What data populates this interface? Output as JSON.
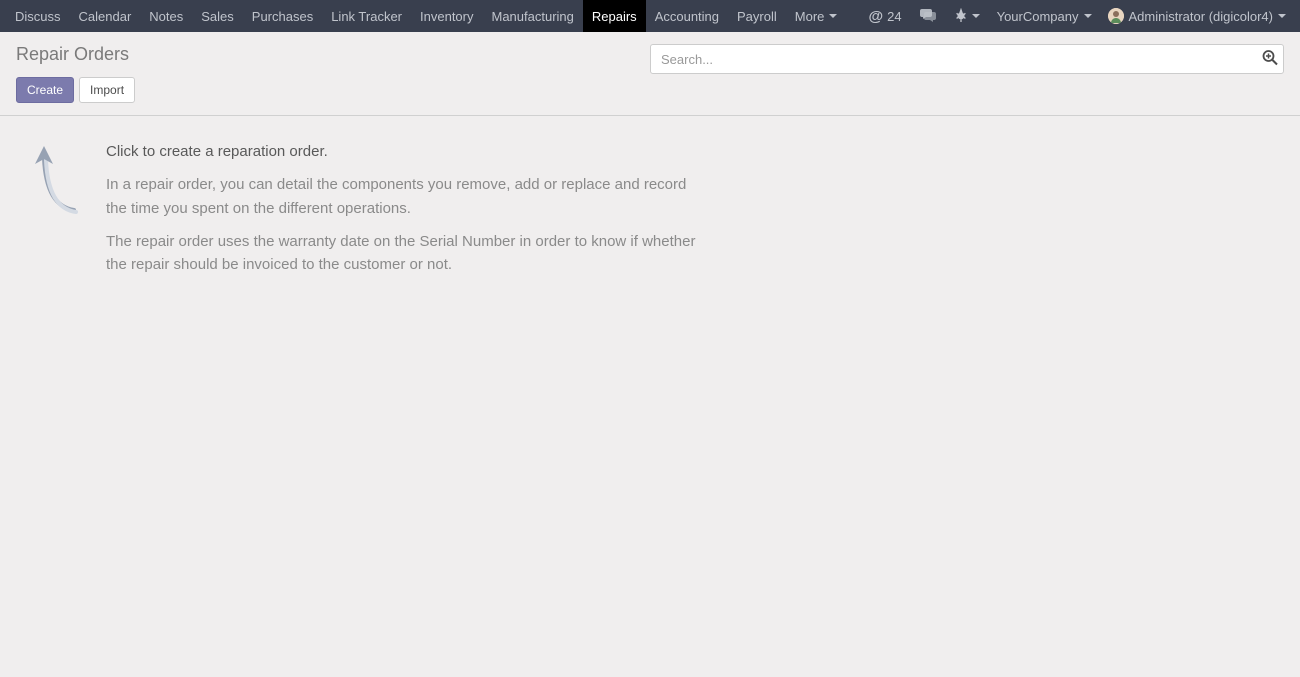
{
  "nav": {
    "items": [
      {
        "label": "Discuss",
        "active": false
      },
      {
        "label": "Calendar",
        "active": false
      },
      {
        "label": "Notes",
        "active": false
      },
      {
        "label": "Sales",
        "active": false
      },
      {
        "label": "Purchases",
        "active": false
      },
      {
        "label": "Link Tracker",
        "active": false
      },
      {
        "label": "Inventory",
        "active": false
      },
      {
        "label": "Manufacturing",
        "active": false
      },
      {
        "label": "Repairs",
        "active": true
      },
      {
        "label": "Accounting",
        "active": false
      },
      {
        "label": "Payroll",
        "active": false
      },
      {
        "label": "More",
        "active": false,
        "dropdown": true
      }
    ],
    "notif_count": "24",
    "company": "YourCompany",
    "user": "Administrator (digicolor4)"
  },
  "control": {
    "title": "Repair Orders",
    "create_label": "Create",
    "import_label": "Import",
    "search_placeholder": "Search..."
  },
  "help": {
    "line1": "Click to create a reparation order.",
    "line2": "In a repair order, you can detail the components you remove, add or replace and record the time you spent on the different operations.",
    "line3": "The repair order uses the warranty date on the Serial Number in order to know if whether the repair should be invoiced to the customer or not."
  }
}
